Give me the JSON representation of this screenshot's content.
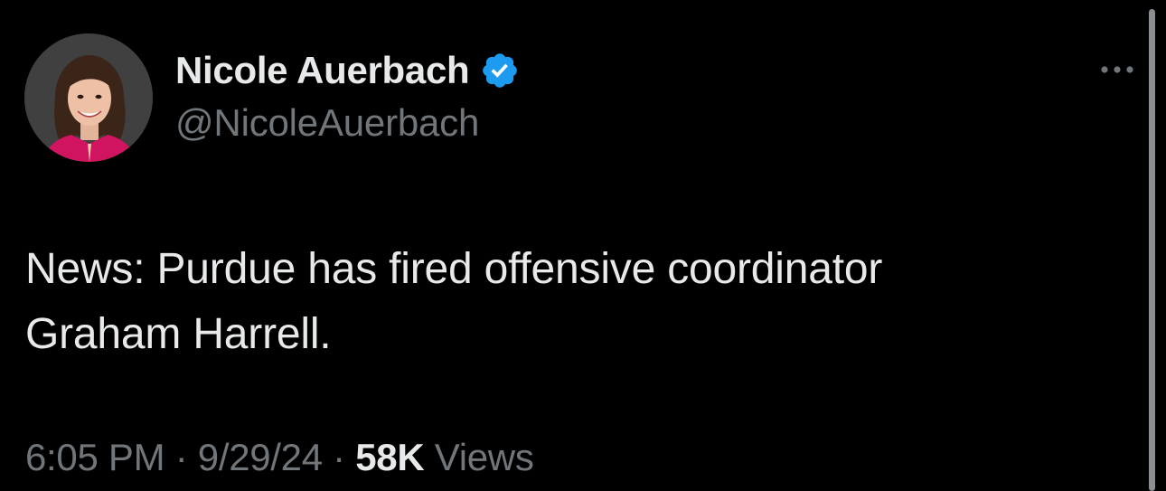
{
  "author": {
    "display_name": "Nicole Auerbach",
    "handle": "@NicoleAuerbach",
    "avatar_icon": "profile-photo",
    "verified_icon": "verified-badge-icon",
    "verified_color": "#1d9bf0"
  },
  "more_icon": "more-options-icon",
  "tweet": {
    "line1": "News: Purdue has fired offensive coordinator",
    "line2": "Graham Harrell."
  },
  "meta": {
    "time": "6:05 PM",
    "separator": " · ",
    "date": "9/29/24",
    "views_count": "58K",
    "views_label": "Views"
  },
  "colors": {
    "background": "#000000",
    "primary_text": "#e7e9ea",
    "secondary_text": "#71767b",
    "accent": "#1d9bf0"
  }
}
